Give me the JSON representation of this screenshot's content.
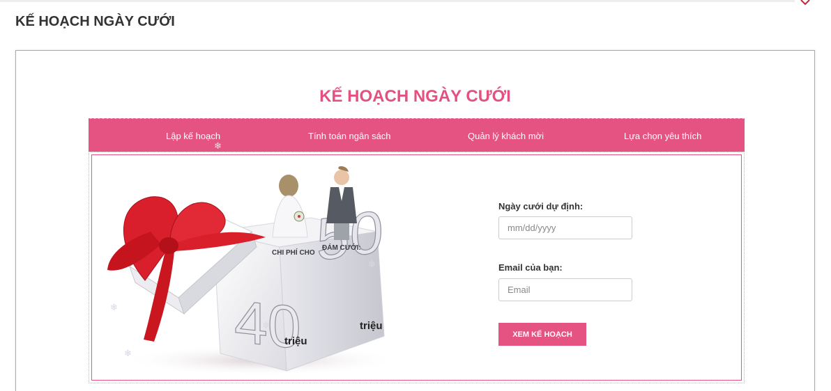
{
  "page": {
    "heading": "KẾ HOẠCH NGÀY CƯỚI"
  },
  "panel": {
    "title": "KẾ HOẠCH NGÀY CƯỚI"
  },
  "nav": {
    "items": [
      {
        "label": "Lập kế hoạch"
      },
      {
        "label": "Tính toán ngân sách"
      },
      {
        "label": "Quản lý khách mời"
      },
      {
        "label": "Lựa chọn yêu thích"
      }
    ]
  },
  "illustration": {
    "caption_left": "CHI PHÍ CHO",
    "caption_right": "ĐÁM CƯỚI:",
    "number_left": "40",
    "number_right": "50",
    "unit_left": "triệu",
    "unit_right": "triệu"
  },
  "form": {
    "date_label": "Ngày cưới dự định:",
    "date_placeholder": "mm/dd/yyyy",
    "email_label": "Email của bạn:",
    "email_placeholder": "Email",
    "submit_label": "XEM KẾ HOẠCH"
  },
  "colors": {
    "accent": "#e55382",
    "heading": "#333333",
    "title": "#e4507f"
  },
  "icons": [
    "snowflake-icon",
    "ribbon-bow-icon",
    "gift-box-icon"
  ]
}
